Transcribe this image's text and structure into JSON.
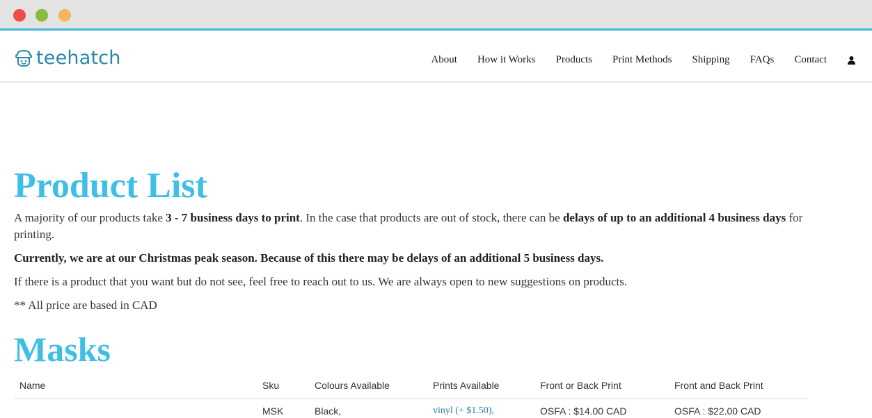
{
  "colors": {
    "accent": "#3fbfe6",
    "brand": "#2a86ad",
    "link": "#2a7aa6",
    "chrome_border": "#3fb5dc"
  },
  "window": {
    "controls": [
      "close",
      "minimize",
      "maximize"
    ]
  },
  "header": {
    "logo_text": "teehatch",
    "logo_icon": "hat-mascot-icon",
    "nav": [
      {
        "label": "About"
      },
      {
        "label": "How it Works"
      },
      {
        "label": "Products"
      },
      {
        "label": "Print Methods"
      },
      {
        "label": "Shipping"
      },
      {
        "label": "FAQs"
      },
      {
        "label": "Contact"
      }
    ],
    "account_icon": "user-icon"
  },
  "main": {
    "title": "Product List",
    "intro": {
      "t1": "A majority of our products take ",
      "b1": "3 - 7 business days to print",
      "t2": ". In the case that products are out of stock, there can be ",
      "b2": "delays of up to an additional 4 business days",
      "t3": " for printing."
    },
    "notice": "Currently, we are at our Christmas peak season. Because of this there may be delays of an additional 5 business days.",
    "suggestion": "If there is a product that you want but do not see, feel free to reach out to us. We are always open to new suggestions on products.",
    "price_note": "** All price are based in CAD"
  },
  "masks": {
    "title": "Masks",
    "columns": [
      "Name",
      "Sku",
      "Colours Available",
      "Prints Available",
      "Front or Back Print",
      "Front and Back Print"
    ],
    "rows": [
      {
        "name": "",
        "sku": "MSK",
        "colours": "Black,",
        "prints": "vinyl (+ $1.50),",
        "front_or_back": "OSFA : $14.00 CAD",
        "front_and_back": "OSFA : $22.00 CAD"
      }
    ]
  }
}
